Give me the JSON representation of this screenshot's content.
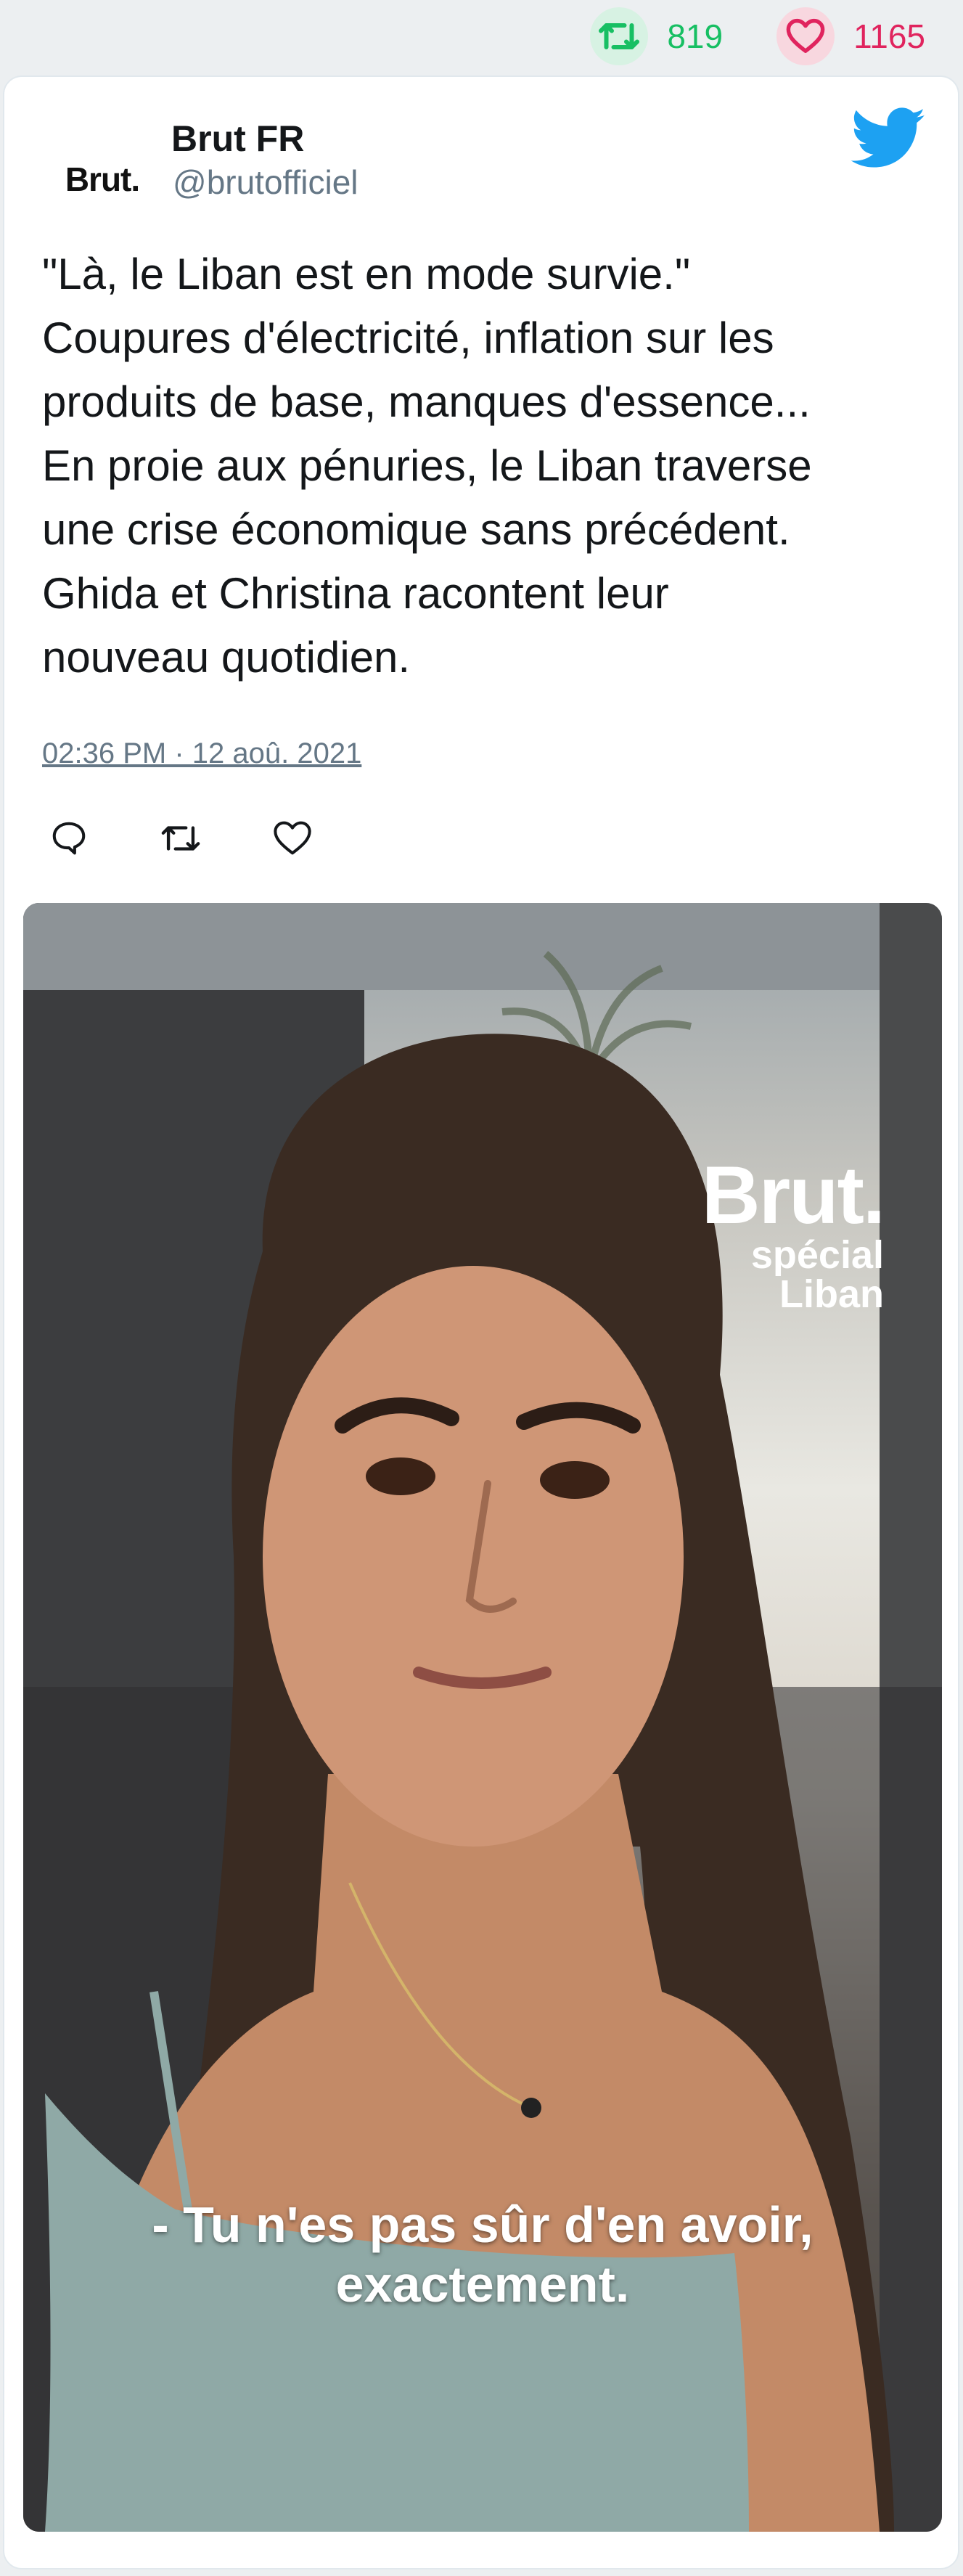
{
  "stats": {
    "retweets": "819",
    "likes": "1165",
    "retweet_icon": "retweet-icon",
    "like_icon": "heart-icon",
    "retweet_color": "#17bf63",
    "like_color": "#e0245e"
  },
  "tweet": {
    "avatar_text": "Brut.",
    "display_name": "Brut FR",
    "handle": "@brutofficiel",
    "brand_icon": "twitter-bird-icon",
    "brand_color": "#1da1f2",
    "text_lines": [
      "\"Là, le Liban est en mode survie.\"",
      "Coupures d'électricité, inflation sur les",
      "produits de base, manques d'essence...",
      "En proie aux pénuries, le Liban traverse",
      "une crise économique sans précédent.",
      "Ghida et Christina racontent leur",
      "nouveau quotidien."
    ],
    "timestamp": "02:36 PM · 12 aoû. 2021",
    "actions": [
      "reply-icon",
      "retweet-icon",
      "like-icon"
    ]
  },
  "media": {
    "watermark_brand": "Brut.",
    "watermark_line1": "spécial",
    "watermark_line2": "Liban",
    "caption_line1": "- Tu n'es pas sûr d'en avoir,",
    "caption_line2": "exactement."
  }
}
